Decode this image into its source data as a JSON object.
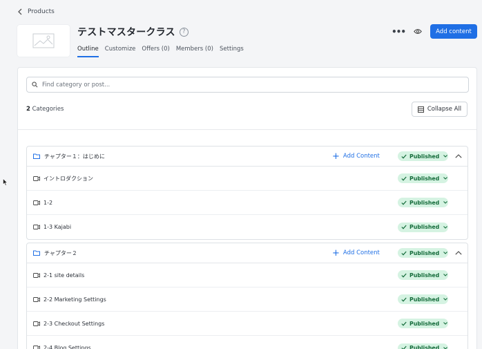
{
  "breadcrumb": {
    "label": "Products"
  },
  "product": {
    "title": "テストマスタークラス",
    "help_icon": "?"
  },
  "tabs": [
    {
      "label": "Outline",
      "active": true
    },
    {
      "label": "Customize"
    },
    {
      "label": "Offers (0)"
    },
    {
      "label": "Members (0)"
    },
    {
      "label": "Settings"
    }
  ],
  "actions": {
    "more_icon": "•••",
    "primary_button": "Add content"
  },
  "search": {
    "placeholder": "Find category or post..."
  },
  "categories": {
    "count": "2",
    "label": " Categories"
  },
  "collapse_all": "Collapse All",
  "status_label": "Published",
  "add_inline_label": "Add Content",
  "chapters": [
    {
      "title": "チャプター１：はじめに",
      "posts": [
        "イントロダクション",
        "1-2",
        "1-3 Kajabi"
      ]
    },
    {
      "title": "チャプター２",
      "posts": [
        "2-1 site details",
        "2-2 Marketing Settings",
        "2-3 Checkout Settings",
        "2-4 Blog Settings"
      ]
    }
  ],
  "colors": {
    "accent": "#1f6fe5",
    "published_bg": "#d5f3e2",
    "published_text": "#146b3a"
  }
}
